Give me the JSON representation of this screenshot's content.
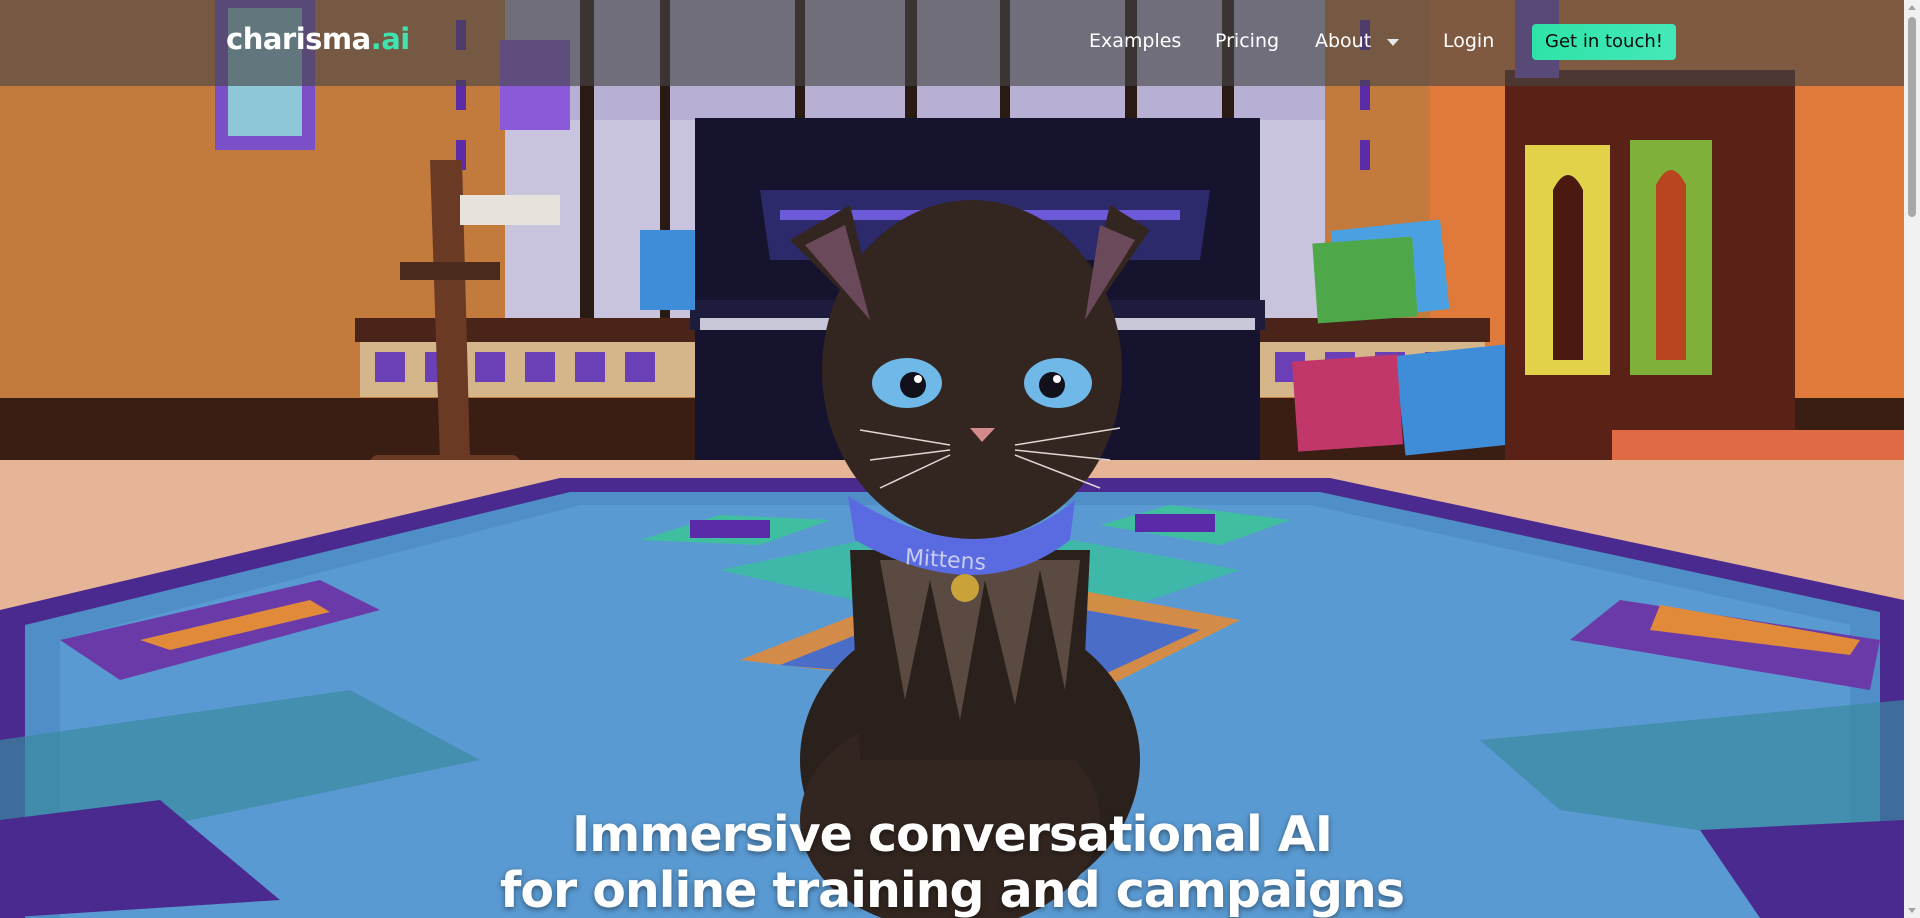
{
  "brand": {
    "logo_main": "charisma",
    "logo_accent": ".ai"
  },
  "nav": {
    "examples": "Examples",
    "pricing": "Pricing",
    "about": "About",
    "login": "Login",
    "cta": "Get in touch!"
  },
  "hero": {
    "headline_line1": "Immersive conversational AI",
    "headline_line2": "for online training and campaigns",
    "collar_text": "Mittens"
  },
  "colors": {
    "accent": "#3fe3b0",
    "cta_bg": "#2ee3a8",
    "navbar_bg": "rgba(70,70,70,0.62)"
  }
}
